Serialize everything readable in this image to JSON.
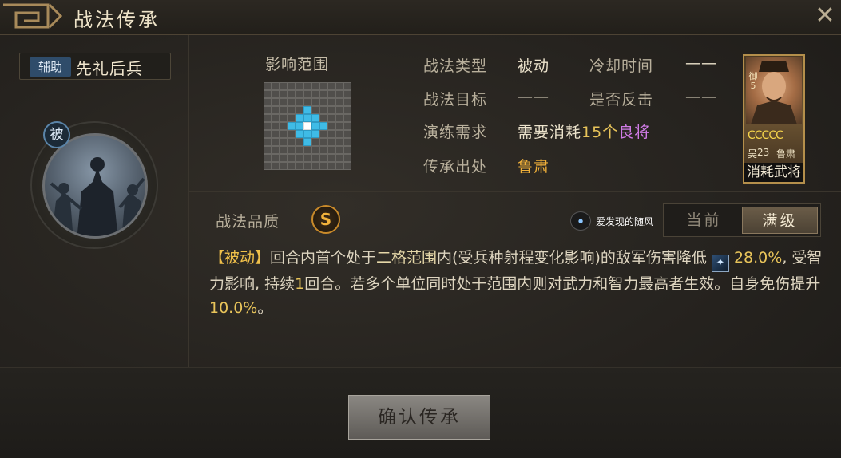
{
  "window": {
    "title": "战法传承"
  },
  "skill": {
    "type_tag": "辅助",
    "name": "先礼后兵",
    "passive_badge": "被"
  },
  "range": {
    "label": "影响范围",
    "cells": [
      "...........",
      "...........",
      "...........",
      ".....H.....",
      "....HHH....",
      "...HHSHH...",
      "....HHH....",
      ".....H.....",
      "...........",
      "...........",
      "..........."
    ]
  },
  "info": {
    "type_label": "战法类型",
    "type_value": "被动",
    "cooldown_label": "冷却时间",
    "cooldown_value": "——",
    "target_label": "战法目标",
    "target_value": "——",
    "counter_label": "是否反击",
    "counter_value": "——",
    "require_label": "演练需求",
    "require_prefix": "需要消耗",
    "require_count": "15个",
    "require_item": "良将",
    "source_label": "传承出处",
    "source_value": "鲁肃"
  },
  "card": {
    "level_vertical": "御5",
    "stars": "CCCCC",
    "camp": "吴",
    "level": "23",
    "name": "鲁肃",
    "caption": "消耗武将"
  },
  "quality": {
    "label": "战法品质",
    "grade": "S"
  },
  "watermark": {
    "text": "爱发现的随风"
  },
  "level_toggle": {
    "current": "当前",
    "max": "满级"
  },
  "description": {
    "tag": "【被动】",
    "p1": "回合内首个处于",
    "range_link": "二格范围",
    "p2": "内(受兵种射程变化影响)的敌军伤害降低",
    "value1": "28.0%",
    "p3": ", 受智力影响, 持续",
    "rounds": "1",
    "p4": "回合。若多个单位同时处于范围内则对武力和智力最高者生效。自身免伤提升",
    "value2": "10.0%",
    "p5": "。"
  },
  "footer": {
    "confirm": "确认传承"
  },
  "icons": {
    "close": "close-icon",
    "attribute": "intelligence-icon"
  }
}
